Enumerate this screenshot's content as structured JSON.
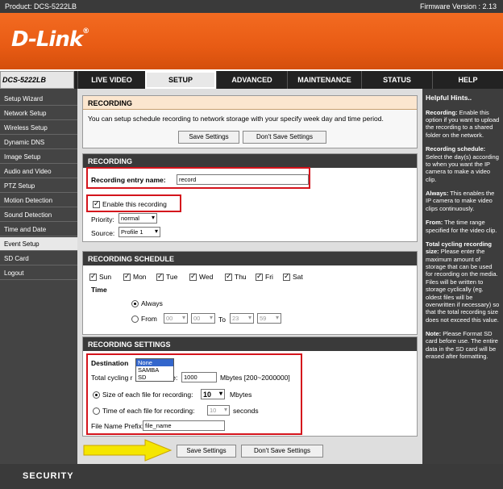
{
  "topbar": {
    "product": "Product: DCS-5222LB",
    "firmware": "Firmware Version : 2.13"
  },
  "brand": {
    "logo_text": "D-Link",
    "registered": "®"
  },
  "nav": {
    "model": "DCS-5222LB",
    "tabs": [
      "LIVE VIDEO",
      "SETUP",
      "ADVANCED",
      "MAINTENANCE",
      "STATUS",
      "HELP"
    ],
    "active_tab": "SETUP"
  },
  "sidebar": {
    "items": [
      "Setup Wizard",
      "Network Setup",
      "Wireless Setup",
      "Dynamic DNS",
      "Image Setup",
      "Audio and Video",
      "PTZ Setup",
      "Motion Detection",
      "Sound Detection",
      "Time and Date",
      "Event Setup",
      "SD Card",
      "Logout"
    ],
    "active": "Event Setup"
  },
  "intro": {
    "title": "RECORDING",
    "description": "You can setup schedule recording to network storage with your specify week day and time period.",
    "save_label": "Save Settings",
    "nosave_label": "Don't Save Settings"
  },
  "recording": {
    "title": "RECORDING",
    "entry_label": "Recording entry name:",
    "entry_value": "record",
    "enable_label": "Enable this recording",
    "enable_checked": true,
    "priority_label": "Priority:",
    "priority_value": "normal",
    "source_label": "Source:",
    "source_value": "Profile 1"
  },
  "schedule": {
    "title": "RECORDING SCHEDULE",
    "days": [
      "Sun",
      "Mon",
      "Tue",
      "Wed",
      "Thu",
      "Fri",
      "Sat"
    ],
    "time_label": "Time",
    "always_label": "Always",
    "from_label": "From",
    "to_label": "To",
    "from_h": "00",
    "from_m": "00",
    "to_h": "23",
    "to_m": "59"
  },
  "settings": {
    "title": "RECORDING SETTINGS",
    "destination_label": "Destination",
    "destination_options": [
      "None",
      "SAMBA",
      "SD"
    ],
    "destination_selected": "None",
    "cycling_label_start": "Total cycling r",
    "cycling_label_end": "ze:",
    "cycling_value": "1000",
    "cycling_unit": "Mbytes [200~2000000]",
    "size_label": "Size of each file for recording:",
    "size_value": "10",
    "size_unit": "Mbytes",
    "time_label": "Time of each file for recording:",
    "time_value": "10",
    "time_unit": "seconds",
    "prefix_label": "File Name Prefix:",
    "prefix_value": "file_name",
    "save_label": "Save Settings",
    "nosave_label": "Don't Save Settings"
  },
  "help": {
    "title": "Helpful Hints..",
    "hints": [
      {
        "term": "Recording:",
        "text": " Enable this option if you want to upload the recording to a shared folder on the network."
      },
      {
        "term": "Recording schedule:",
        "text": " Select the day(s) according to when you want the IP camera to make a video clip."
      },
      {
        "term": "Always:",
        "text": " This enables the IP camera to make video clips continuously."
      },
      {
        "term": "From:",
        "text": " The time range specified for the video clip."
      },
      {
        "term": "Total cycling recording size:",
        "text": " Please enter the maximum amount of storage that can be used for recording on the media. Files will be written to storage cyclically (eg. oldest files will be overwritten if necessary) so that the total recording size does not exceed this value."
      },
      {
        "term": "Note:",
        "text": " Please Format SD card before use. The entire data in the SD card will be erased after formatting."
      }
    ]
  },
  "footer": {
    "label": "SECURITY"
  },
  "colors": {
    "accent": "#e85b14",
    "highlight": "#d4141c",
    "arrow": "#f5e600"
  }
}
